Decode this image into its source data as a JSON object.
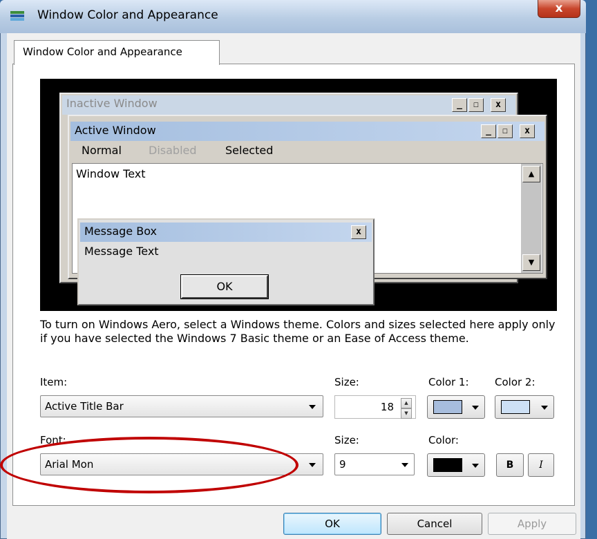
{
  "window": {
    "title": "Window Color and Appearance",
    "close_glyph": "x",
    "tab_label": "Window Color and Appearance"
  },
  "preview": {
    "inactive_title": "Inactive Window",
    "active_title": "Active Window",
    "caption_glyphs": {
      "minimize": "_",
      "maximize": "☐",
      "close": "x"
    },
    "menu": {
      "normal": "Normal",
      "disabled": "Disabled",
      "selected": "Selected"
    },
    "window_text": "Window Text",
    "message_box": {
      "title": "Message Box",
      "text": "Message Text",
      "ok_label": "OK"
    }
  },
  "description": "To turn on Windows Aero, select a Windows theme.  Colors and sizes selected here apply only if you have selected the Windows 7 Basic theme or an Ease of Access theme.",
  "item_row": {
    "item_label": "Item:",
    "item_value": "Active Title Bar",
    "size_label": "Size:",
    "size_value": "18",
    "color1_label": "Color 1:",
    "color2_label": "Color 2:",
    "color1_swatch": "#a7bddd",
    "color2_swatch": "#cde0f5"
  },
  "font_row": {
    "font_label": "Font:",
    "font_value": "Arial Mon",
    "size_label": "Size:",
    "size_value": "9",
    "color_label": "Color:",
    "color_swatch": "#000000",
    "bold_label": "B",
    "italic_label": "I"
  },
  "buttons": {
    "ok": "OK",
    "cancel": "Cancel",
    "apply": "Apply"
  },
  "annotation": {
    "highlight_color": "#c00000"
  }
}
